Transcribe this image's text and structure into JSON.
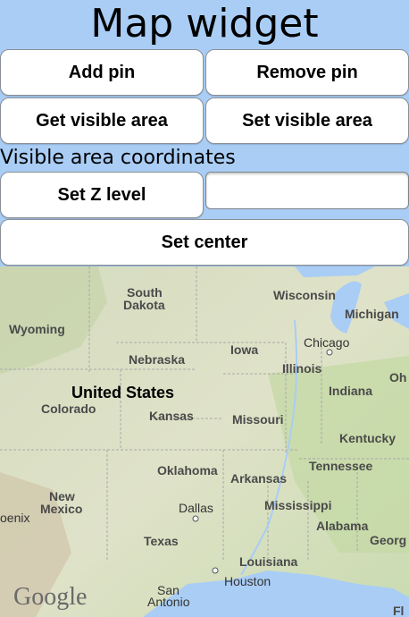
{
  "header": {
    "title": "Map widget"
  },
  "buttons": {
    "add_pin": "Add pin",
    "remove_pin": "Remove pin",
    "get_visible_area": "Get visible area",
    "set_visible_area": "Set visible area",
    "set_z_level": "Set Z level",
    "set_center": "Set center"
  },
  "labels": {
    "visible_area": "Visible area coordinates"
  },
  "z_level_input": {
    "value": "",
    "placeholder": ""
  },
  "map": {
    "attribution": "Google",
    "places": {
      "wyoming": "Wyoming",
      "south_dakota_1": "South",
      "south_dakota_2": "Dakota",
      "wisconsin": "Wisconsin",
      "michigan": "Michigan",
      "chicago": "Chicago",
      "iowa": "Iowa",
      "nebraska": "Nebraska",
      "illinois": "Illinois",
      "ohio": "Oh",
      "united_states": "United States",
      "indiana": "Indiana",
      "colorado": "Colorado",
      "kansas": "Kansas",
      "missouri": "Missouri",
      "kentucky": "Kentucky",
      "tennessee": "Tennessee",
      "oklahoma": "Oklahoma",
      "arkansas": "Arkansas",
      "new_mexico_1": "New",
      "new_mexico_2": "Mexico",
      "phoenix": "oenix",
      "dallas": "Dallas",
      "mississippi": "Mississippi",
      "alabama": "Alabama",
      "georgia": "Georg",
      "texas": "Texas",
      "louisiana": "Louisiana",
      "houston": "Houston",
      "san_antonio_1": "San",
      "san_antonio_2": "Antonio",
      "florida": "Fl"
    }
  }
}
